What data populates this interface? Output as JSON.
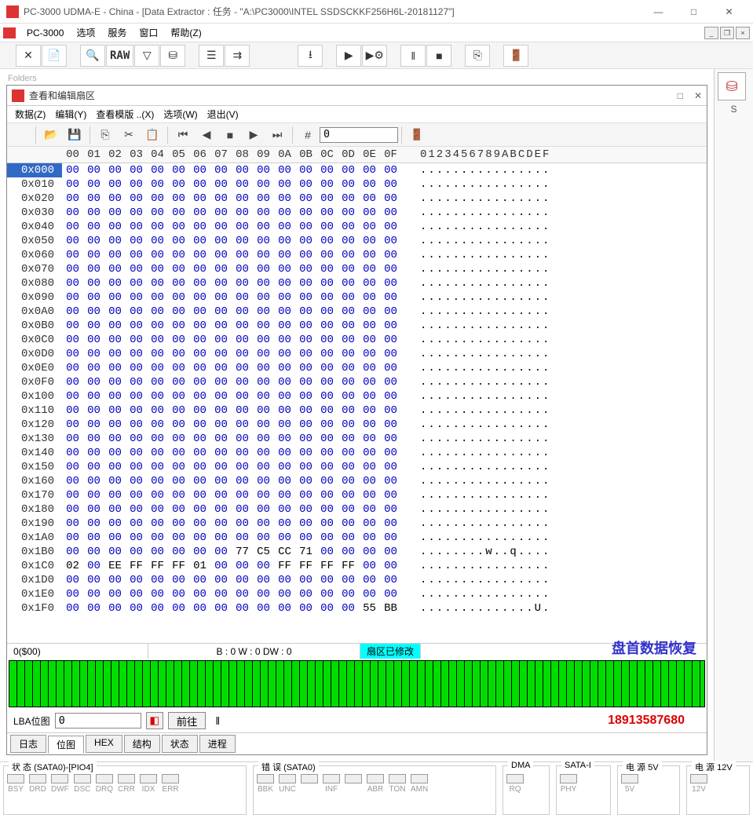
{
  "window": {
    "title": "PC-3000 UDMA-E - China - [Data Extractor : 任务 - \"A:\\PC3000\\INTEL SSDSCKKF256H6L-20181127\"]"
  },
  "menu": {
    "app": "PC-3000",
    "items": [
      "选项",
      "服务",
      "窗口",
      "帮助(Z)"
    ]
  },
  "toolbar": {
    "raw": "RAW"
  },
  "folders_hint": "Folders",
  "inner": {
    "title": "查看和编辑扇区",
    "menu": [
      "数据(Z)",
      "编辑(Y)",
      "查看模版 ..(X)",
      "选项(W)",
      "退出(V)"
    ],
    "offset_input": "0",
    "header_cols": [
      "00",
      "01",
      "02",
      "03",
      "04",
      "05",
      "06",
      "07",
      "08",
      "09",
      "0A",
      "0B",
      "0C",
      "0D",
      "0E",
      "0F"
    ],
    "header_ascii": "0123456789ABCDEF",
    "rows": [
      {
        "off": "0x000",
        "hex": [
          "00",
          "00",
          "00",
          "00",
          "00",
          "00",
          "00",
          "00",
          "00",
          "00",
          "00",
          "00",
          "00",
          "00",
          "00",
          "00"
        ],
        "asc": "................"
      },
      {
        "off": "0x010",
        "hex": [
          "00",
          "00",
          "00",
          "00",
          "00",
          "00",
          "00",
          "00",
          "00",
          "00",
          "00",
          "00",
          "00",
          "00",
          "00",
          "00"
        ],
        "asc": "................"
      },
      {
        "off": "0x020",
        "hex": [
          "00",
          "00",
          "00",
          "00",
          "00",
          "00",
          "00",
          "00",
          "00",
          "00",
          "00",
          "00",
          "00",
          "00",
          "00",
          "00"
        ],
        "asc": "................"
      },
      {
        "off": "0x030",
        "hex": [
          "00",
          "00",
          "00",
          "00",
          "00",
          "00",
          "00",
          "00",
          "00",
          "00",
          "00",
          "00",
          "00",
          "00",
          "00",
          "00"
        ],
        "asc": "................"
      },
      {
        "off": "0x040",
        "hex": [
          "00",
          "00",
          "00",
          "00",
          "00",
          "00",
          "00",
          "00",
          "00",
          "00",
          "00",
          "00",
          "00",
          "00",
          "00",
          "00"
        ],
        "asc": "................"
      },
      {
        "off": "0x050",
        "hex": [
          "00",
          "00",
          "00",
          "00",
          "00",
          "00",
          "00",
          "00",
          "00",
          "00",
          "00",
          "00",
          "00",
          "00",
          "00",
          "00"
        ],
        "asc": "................"
      },
      {
        "off": "0x060",
        "hex": [
          "00",
          "00",
          "00",
          "00",
          "00",
          "00",
          "00",
          "00",
          "00",
          "00",
          "00",
          "00",
          "00",
          "00",
          "00",
          "00"
        ],
        "asc": "................"
      },
      {
        "off": "0x070",
        "hex": [
          "00",
          "00",
          "00",
          "00",
          "00",
          "00",
          "00",
          "00",
          "00",
          "00",
          "00",
          "00",
          "00",
          "00",
          "00",
          "00"
        ],
        "asc": "................"
      },
      {
        "off": "0x080",
        "hex": [
          "00",
          "00",
          "00",
          "00",
          "00",
          "00",
          "00",
          "00",
          "00",
          "00",
          "00",
          "00",
          "00",
          "00",
          "00",
          "00"
        ],
        "asc": "................"
      },
      {
        "off": "0x090",
        "hex": [
          "00",
          "00",
          "00",
          "00",
          "00",
          "00",
          "00",
          "00",
          "00",
          "00",
          "00",
          "00",
          "00",
          "00",
          "00",
          "00"
        ],
        "asc": "................"
      },
      {
        "off": "0x0A0",
        "hex": [
          "00",
          "00",
          "00",
          "00",
          "00",
          "00",
          "00",
          "00",
          "00",
          "00",
          "00",
          "00",
          "00",
          "00",
          "00",
          "00"
        ],
        "asc": "................"
      },
      {
        "off": "0x0B0",
        "hex": [
          "00",
          "00",
          "00",
          "00",
          "00",
          "00",
          "00",
          "00",
          "00",
          "00",
          "00",
          "00",
          "00",
          "00",
          "00",
          "00"
        ],
        "asc": "................"
      },
      {
        "off": "0x0C0",
        "hex": [
          "00",
          "00",
          "00",
          "00",
          "00",
          "00",
          "00",
          "00",
          "00",
          "00",
          "00",
          "00",
          "00",
          "00",
          "00",
          "00"
        ],
        "asc": "................"
      },
      {
        "off": "0x0D0",
        "hex": [
          "00",
          "00",
          "00",
          "00",
          "00",
          "00",
          "00",
          "00",
          "00",
          "00",
          "00",
          "00",
          "00",
          "00",
          "00",
          "00"
        ],
        "asc": "................"
      },
      {
        "off": "0x0E0",
        "hex": [
          "00",
          "00",
          "00",
          "00",
          "00",
          "00",
          "00",
          "00",
          "00",
          "00",
          "00",
          "00",
          "00",
          "00",
          "00",
          "00"
        ],
        "asc": "................"
      },
      {
        "off": "0x0F0",
        "hex": [
          "00",
          "00",
          "00",
          "00",
          "00",
          "00",
          "00",
          "00",
          "00",
          "00",
          "00",
          "00",
          "00",
          "00",
          "00",
          "00"
        ],
        "asc": "................"
      },
      {
        "off": "0x100",
        "hex": [
          "00",
          "00",
          "00",
          "00",
          "00",
          "00",
          "00",
          "00",
          "00",
          "00",
          "00",
          "00",
          "00",
          "00",
          "00",
          "00"
        ],
        "asc": "................"
      },
      {
        "off": "0x110",
        "hex": [
          "00",
          "00",
          "00",
          "00",
          "00",
          "00",
          "00",
          "00",
          "00",
          "00",
          "00",
          "00",
          "00",
          "00",
          "00",
          "00"
        ],
        "asc": "................"
      },
      {
        "off": "0x120",
        "hex": [
          "00",
          "00",
          "00",
          "00",
          "00",
          "00",
          "00",
          "00",
          "00",
          "00",
          "00",
          "00",
          "00",
          "00",
          "00",
          "00"
        ],
        "asc": "................"
      },
      {
        "off": "0x130",
        "hex": [
          "00",
          "00",
          "00",
          "00",
          "00",
          "00",
          "00",
          "00",
          "00",
          "00",
          "00",
          "00",
          "00",
          "00",
          "00",
          "00"
        ],
        "asc": "................"
      },
      {
        "off": "0x140",
        "hex": [
          "00",
          "00",
          "00",
          "00",
          "00",
          "00",
          "00",
          "00",
          "00",
          "00",
          "00",
          "00",
          "00",
          "00",
          "00",
          "00"
        ],
        "asc": "................"
      },
      {
        "off": "0x150",
        "hex": [
          "00",
          "00",
          "00",
          "00",
          "00",
          "00",
          "00",
          "00",
          "00",
          "00",
          "00",
          "00",
          "00",
          "00",
          "00",
          "00"
        ],
        "asc": "................"
      },
      {
        "off": "0x160",
        "hex": [
          "00",
          "00",
          "00",
          "00",
          "00",
          "00",
          "00",
          "00",
          "00",
          "00",
          "00",
          "00",
          "00",
          "00",
          "00",
          "00"
        ],
        "asc": "................"
      },
      {
        "off": "0x170",
        "hex": [
          "00",
          "00",
          "00",
          "00",
          "00",
          "00",
          "00",
          "00",
          "00",
          "00",
          "00",
          "00",
          "00",
          "00",
          "00",
          "00"
        ],
        "asc": "................"
      },
      {
        "off": "0x180",
        "hex": [
          "00",
          "00",
          "00",
          "00",
          "00",
          "00",
          "00",
          "00",
          "00",
          "00",
          "00",
          "00",
          "00",
          "00",
          "00",
          "00"
        ],
        "asc": "................"
      },
      {
        "off": "0x190",
        "hex": [
          "00",
          "00",
          "00",
          "00",
          "00",
          "00",
          "00",
          "00",
          "00",
          "00",
          "00",
          "00",
          "00",
          "00",
          "00",
          "00"
        ],
        "asc": "................"
      },
      {
        "off": "0x1A0",
        "hex": [
          "00",
          "00",
          "00",
          "00",
          "00",
          "00",
          "00",
          "00",
          "00",
          "00",
          "00",
          "00",
          "00",
          "00",
          "00",
          "00"
        ],
        "asc": "................"
      },
      {
        "off": "0x1B0",
        "hex": [
          "00",
          "00",
          "00",
          "00",
          "00",
          "00",
          "00",
          "00",
          "77",
          "C5",
          "CC",
          "71",
          "00",
          "00",
          "00",
          "00"
        ],
        "asc": "........w..q...."
      },
      {
        "off": "0x1C0",
        "hex": [
          "02",
          "00",
          "EE",
          "FF",
          "FF",
          "FF",
          "01",
          "00",
          "00",
          "00",
          "FF",
          "FF",
          "FF",
          "FF",
          "00",
          "00"
        ],
        "asc": "................"
      },
      {
        "off": "0x1D0",
        "hex": [
          "00",
          "00",
          "00",
          "00",
          "00",
          "00",
          "00",
          "00",
          "00",
          "00",
          "00",
          "00",
          "00",
          "00",
          "00",
          "00"
        ],
        "asc": "................"
      },
      {
        "off": "0x1E0",
        "hex": [
          "00",
          "00",
          "00",
          "00",
          "00",
          "00",
          "00",
          "00",
          "00",
          "00",
          "00",
          "00",
          "00",
          "00",
          "00",
          "00"
        ],
        "asc": "................"
      },
      {
        "off": "0x1F0",
        "hex": [
          "00",
          "00",
          "00",
          "00",
          "00",
          "00",
          "00",
          "00",
          "00",
          "00",
          "00",
          "00",
          "00",
          "00",
          "55",
          "BB"
        ],
        "asc": "..............U."
      }
    ],
    "status": {
      "offset": "0($00)",
      "pos": "B : 0 W : 0 DW : 0",
      "modified": "扇区已修改"
    },
    "lba": {
      "label": "LBA位图",
      "value": "0",
      "go": "前往"
    },
    "tabs": [
      "日志",
      "位图",
      "HEX",
      "结构",
      "状态",
      "进程"
    ],
    "active_tab": "位图"
  },
  "watermark_text": "盘首数据恢复",
  "phone": "18913587680",
  "bottom": {
    "status_label": "状 态 (SATA0)-[PIO4]",
    "status_leds": [
      "BSY",
      "DRD",
      "DWF",
      "DSC",
      "DRQ",
      "CRR",
      "IDX",
      "ERR"
    ],
    "error_label": "错 误 (SATA0)",
    "error_leds": [
      "BBK",
      "UNC",
      "",
      "INF",
      "",
      "ABR",
      "TON",
      "AMN"
    ],
    "dma": {
      "label": "DMA",
      "led": "RQ"
    },
    "sata": {
      "label": "SATA-I",
      "led": "PHY"
    },
    "p5": {
      "label": "电 源  5V",
      "led": "5V"
    },
    "p12": {
      "label": "电 源  12V",
      "led": "12V"
    }
  }
}
